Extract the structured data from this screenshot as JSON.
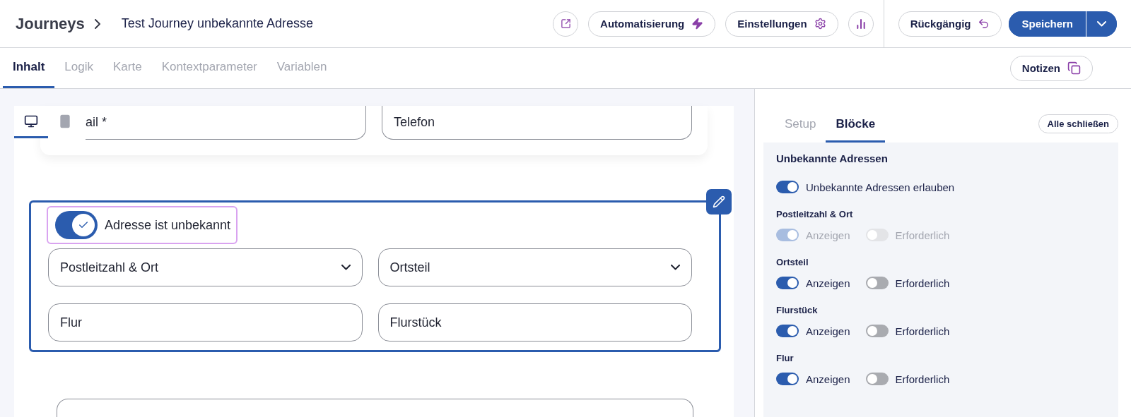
{
  "header": {
    "breadcrumb": "Journeys",
    "title": "Test Journey unbekannte Adresse",
    "actions": [
      {
        "kind": "open"
      },
      {
        "kind": "automation",
        "label": "Automatisierung"
      },
      {
        "kind": "settings",
        "label": "Einstellungen"
      },
      {
        "kind": "stats"
      }
    ],
    "undo": "Rückgängig",
    "save": "Speichern"
  },
  "tabs": [
    {
      "label": "Inhalt",
      "selected": true
    },
    {
      "label": "Logik",
      "selected": false
    },
    {
      "label": "Karte",
      "selected": false
    },
    {
      "label": "Kontextparameter",
      "selected": false
    },
    {
      "label": "Variablen",
      "selected": false
    }
  ],
  "notes_button": "Notizen",
  "preview": {
    "devices": [
      {
        "kind": "desktop",
        "selected": true
      },
      {
        "kind": "mobile",
        "selected": false
      }
    ],
    "top_fields": [
      "ail *",
      "Telefon"
    ],
    "block": {
      "toggle": {
        "label": "Adresse ist unbekannt",
        "on": true
      },
      "fields": [
        {
          "kind": "select",
          "label": "Postleitzahl & Ort"
        },
        {
          "kind": "select",
          "label": "Ortsteil"
        },
        {
          "kind": "text",
          "label": "Flur"
        },
        {
          "kind": "text",
          "label": "Flurstück"
        }
      ]
    }
  },
  "sidebar": {
    "tabs": [
      {
        "label": "Setup",
        "selected": false
      },
      {
        "label": "Blöcke",
        "selected": true
      }
    ],
    "close_all": "Alle schließen",
    "section_title": "Unbekannte Adressen",
    "allow": {
      "label": "Unbekannte Adressen erlauben",
      "on": true
    },
    "groups": [
      {
        "title": "Postleitzahl & Ort",
        "toggles": [
          {
            "label": "Anzeigen",
            "on": true,
            "disabled": true
          },
          {
            "label": "Erforderlich",
            "on": false,
            "disabled": true
          }
        ]
      },
      {
        "title": "Ortsteil",
        "toggles": [
          {
            "label": "Anzeigen",
            "on": true,
            "disabled": false
          },
          {
            "label": "Erforderlich",
            "on": false,
            "disabled": false
          }
        ]
      },
      {
        "title": "Flurstück",
        "toggles": [
          {
            "label": "Anzeigen",
            "on": true,
            "disabled": false
          },
          {
            "label": "Erforderlich",
            "on": false,
            "disabled": false
          }
        ]
      },
      {
        "title": "Flur",
        "toggles": [
          {
            "label": "Anzeigen",
            "on": true,
            "disabled": false
          },
          {
            "label": "Erforderlich",
            "on": false,
            "disabled": false
          }
        ]
      }
    ]
  }
}
